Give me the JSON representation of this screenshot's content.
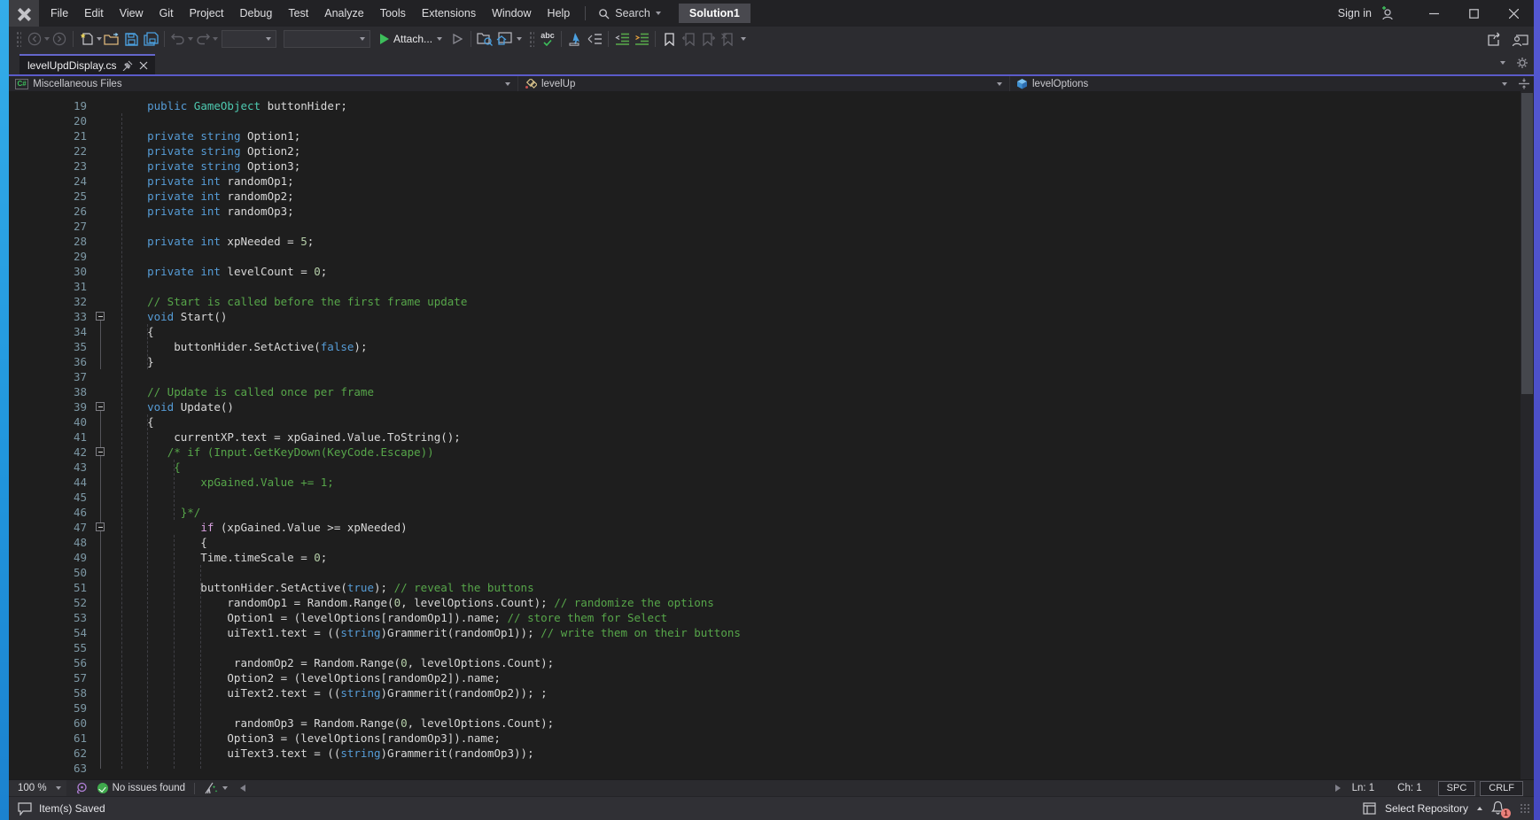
{
  "window": {
    "menu": [
      "File",
      "Edit",
      "View",
      "Git",
      "Project",
      "Debug",
      "Test",
      "Analyze",
      "Tools",
      "Extensions",
      "Window",
      "Help"
    ],
    "search_label": "Search",
    "solution_label": "Solution1",
    "sign_in_label": "Sign in"
  },
  "toolbar": {
    "attach_label": "Attach...",
    "abc_icon_text": "abc"
  },
  "tabs": {
    "active_tab": "levelUpdDisplay.cs"
  },
  "navbar": {
    "file_icon_text": "C#",
    "scope": "Miscellaneous Files",
    "type": "levelUp",
    "member": "levelOptions"
  },
  "editor": {
    "lines": [
      {
        "n": 19,
        "t": [
          [
            "pl",
            "    "
          ],
          [
            "k",
            "public"
          ],
          [
            "pl",
            " "
          ],
          [
            "ty",
            "GameObject"
          ],
          [
            "pl",
            " buttonHider;"
          ]
        ]
      },
      {
        "n": 20,
        "t": []
      },
      {
        "n": 21,
        "t": [
          [
            "pl",
            "    "
          ],
          [
            "k",
            "private"
          ],
          [
            "pl",
            " "
          ],
          [
            "k",
            "string"
          ],
          [
            "pl",
            " Option1;"
          ]
        ]
      },
      {
        "n": 22,
        "t": [
          [
            "pl",
            "    "
          ],
          [
            "k",
            "private"
          ],
          [
            "pl",
            " "
          ],
          [
            "k",
            "string"
          ],
          [
            "pl",
            " Option2;"
          ]
        ]
      },
      {
        "n": 23,
        "t": [
          [
            "pl",
            "    "
          ],
          [
            "k",
            "private"
          ],
          [
            "pl",
            " "
          ],
          [
            "k",
            "string"
          ],
          [
            "pl",
            " Option3;"
          ]
        ]
      },
      {
        "n": 24,
        "t": [
          [
            "pl",
            "    "
          ],
          [
            "k",
            "private"
          ],
          [
            "pl",
            " "
          ],
          [
            "k",
            "int"
          ],
          [
            "pl",
            " randomOp1;"
          ]
        ]
      },
      {
        "n": 25,
        "t": [
          [
            "pl",
            "    "
          ],
          [
            "k",
            "private"
          ],
          [
            "pl",
            " "
          ],
          [
            "k",
            "int"
          ],
          [
            "pl",
            " randomOp2;"
          ]
        ]
      },
      {
        "n": 26,
        "t": [
          [
            "pl",
            "    "
          ],
          [
            "k",
            "private"
          ],
          [
            "pl",
            " "
          ],
          [
            "k",
            "int"
          ],
          [
            "pl",
            " randomOp3;"
          ]
        ]
      },
      {
        "n": 27,
        "t": []
      },
      {
        "n": 28,
        "t": [
          [
            "pl",
            "    "
          ],
          [
            "k",
            "private"
          ],
          [
            "pl",
            " "
          ],
          [
            "k",
            "int"
          ],
          [
            "pl",
            " xpNeeded = "
          ],
          [
            "nu",
            "5"
          ],
          [
            "pl",
            ";"
          ]
        ]
      },
      {
        "n": 29,
        "t": []
      },
      {
        "n": 30,
        "t": [
          [
            "pl",
            "    "
          ],
          [
            "k",
            "private"
          ],
          [
            "pl",
            " "
          ],
          [
            "k",
            "int"
          ],
          [
            "pl",
            " levelCount = "
          ],
          [
            "nu",
            "0"
          ],
          [
            "pl",
            ";"
          ]
        ]
      },
      {
        "n": 31,
        "t": []
      },
      {
        "n": 32,
        "t": [
          [
            "pl",
            "    "
          ],
          [
            "cm",
            "// Start is called before the first frame update"
          ]
        ]
      },
      {
        "n": 33,
        "f": 1,
        "t": [
          [
            "pl",
            "    "
          ],
          [
            "k",
            "void"
          ],
          [
            "pl",
            " Start()"
          ]
        ]
      },
      {
        "n": 34,
        "t": [
          [
            "pl",
            "    {"
          ]
        ]
      },
      {
        "n": 35,
        "t": [
          [
            "pl",
            "        buttonHider.SetActive("
          ],
          [
            "k",
            "false"
          ],
          [
            "pl",
            ");"
          ]
        ]
      },
      {
        "n": 36,
        "t": [
          [
            "pl",
            "    }"
          ]
        ]
      },
      {
        "n": 37,
        "t": []
      },
      {
        "n": 38,
        "t": [
          [
            "pl",
            "    "
          ],
          [
            "cm",
            "// Update is called once per frame"
          ]
        ]
      },
      {
        "n": 39,
        "f": 1,
        "t": [
          [
            "pl",
            "    "
          ],
          [
            "k",
            "void"
          ],
          [
            "pl",
            " Update()"
          ]
        ]
      },
      {
        "n": 40,
        "t": [
          [
            "pl",
            "    {"
          ]
        ]
      },
      {
        "n": 41,
        "t": [
          [
            "pl",
            "        currentXP.text = xpGained.Value.ToString();"
          ]
        ]
      },
      {
        "n": 42,
        "f": 1,
        "t": [
          [
            "pl",
            "       "
          ],
          [
            "cm",
            "/* if (Input.GetKeyDown(KeyCode.Escape))"
          ]
        ]
      },
      {
        "n": 43,
        "t": [
          [
            "pl",
            "        "
          ],
          [
            "cm",
            "{"
          ]
        ]
      },
      {
        "n": 44,
        "t": [
          [
            "pl",
            "            "
          ],
          [
            "cm",
            "xpGained.Value += 1;"
          ]
        ]
      },
      {
        "n": 45,
        "t": []
      },
      {
        "n": 46,
        "t": [
          [
            "pl",
            "         "
          ],
          [
            "cm",
            "}*/"
          ]
        ]
      },
      {
        "n": 47,
        "f": 1,
        "t": [
          [
            "pl",
            "            "
          ],
          [
            "c",
            "if"
          ],
          [
            "pl",
            " (xpGained.Value >= xpNeeded)"
          ]
        ]
      },
      {
        "n": 48,
        "t": [
          [
            "pl",
            "            {"
          ]
        ]
      },
      {
        "n": 49,
        "t": [
          [
            "pl",
            "            Time.timeScale = "
          ],
          [
            "nu",
            "0"
          ],
          [
            "pl",
            ";"
          ]
        ]
      },
      {
        "n": 50,
        "t": []
      },
      {
        "n": 51,
        "t": [
          [
            "pl",
            "            buttonHider.SetActive("
          ],
          [
            "k",
            "true"
          ],
          [
            "pl",
            "); "
          ],
          [
            "cm",
            "// reveal the buttons"
          ]
        ]
      },
      {
        "n": 52,
        "t": [
          [
            "pl",
            "                randomOp1 = Random.Range("
          ],
          [
            "nu",
            "0"
          ],
          [
            "pl",
            ", levelOptions.Count); "
          ],
          [
            "cm",
            "// randomize the options"
          ]
        ]
      },
      {
        "n": 53,
        "t": [
          [
            "pl",
            "                Option1 = (levelOptions[randomOp1]).name; "
          ],
          [
            "cm",
            "// store them for Select"
          ]
        ]
      },
      {
        "n": 54,
        "t": [
          [
            "pl",
            "                uiText1.text = (("
          ],
          [
            "k",
            "string"
          ],
          [
            "pl",
            ")Grammerit(randomOp1)); "
          ],
          [
            "cm",
            "// write them on their buttons"
          ]
        ]
      },
      {
        "n": 55,
        "t": []
      },
      {
        "n": 56,
        "t": [
          [
            "pl",
            "                 randomOp2 = Random.Range("
          ],
          [
            "nu",
            "0"
          ],
          [
            "pl",
            ", levelOptions.Count);"
          ]
        ]
      },
      {
        "n": 57,
        "t": [
          [
            "pl",
            "                Option2 = (levelOptions[randomOp2]).name;"
          ]
        ]
      },
      {
        "n": 58,
        "t": [
          [
            "pl",
            "                uiText2.text = (("
          ],
          [
            "k",
            "string"
          ],
          [
            "pl",
            ")Grammerit(randomOp2)); ;"
          ]
        ]
      },
      {
        "n": 59,
        "t": []
      },
      {
        "n": 60,
        "t": [
          [
            "pl",
            "                 randomOp3 = Random.Range("
          ],
          [
            "nu",
            "0"
          ],
          [
            "pl",
            ", levelOptions.Count);"
          ]
        ]
      },
      {
        "n": 61,
        "t": [
          [
            "pl",
            "                Option3 = (levelOptions[randomOp3]).name;"
          ]
        ]
      },
      {
        "n": 62,
        "t": [
          [
            "pl",
            "                uiText3.text = (("
          ],
          [
            "k",
            "string"
          ],
          [
            "pl",
            ")Grammerit(randomOp3));"
          ]
        ]
      },
      {
        "n": 63,
        "t": []
      }
    ]
  },
  "editor_footer": {
    "zoom": "100 %",
    "health": "No issues found",
    "ln": "Ln: 1",
    "ch": "Ch: 1",
    "spc": "SPC",
    "eol": "CRLF"
  },
  "status_bar": {
    "message": "Item(s) Saved",
    "repository": "Select Repository",
    "notification_count": "1"
  },
  "colors": {
    "accent_tab_purple": "#5b5bc9",
    "desktop_left_blue": "#2aa0e2",
    "desktop_right_purple": "#4d51c9",
    "editor_bg": "#1e1e1e",
    "keyword_blue": "#569cd6",
    "comment_green": "#57a64a",
    "type_teal": "#4ec9b0",
    "number_green": "#b5cea8",
    "attach_play_green": "#3dbe5b"
  }
}
